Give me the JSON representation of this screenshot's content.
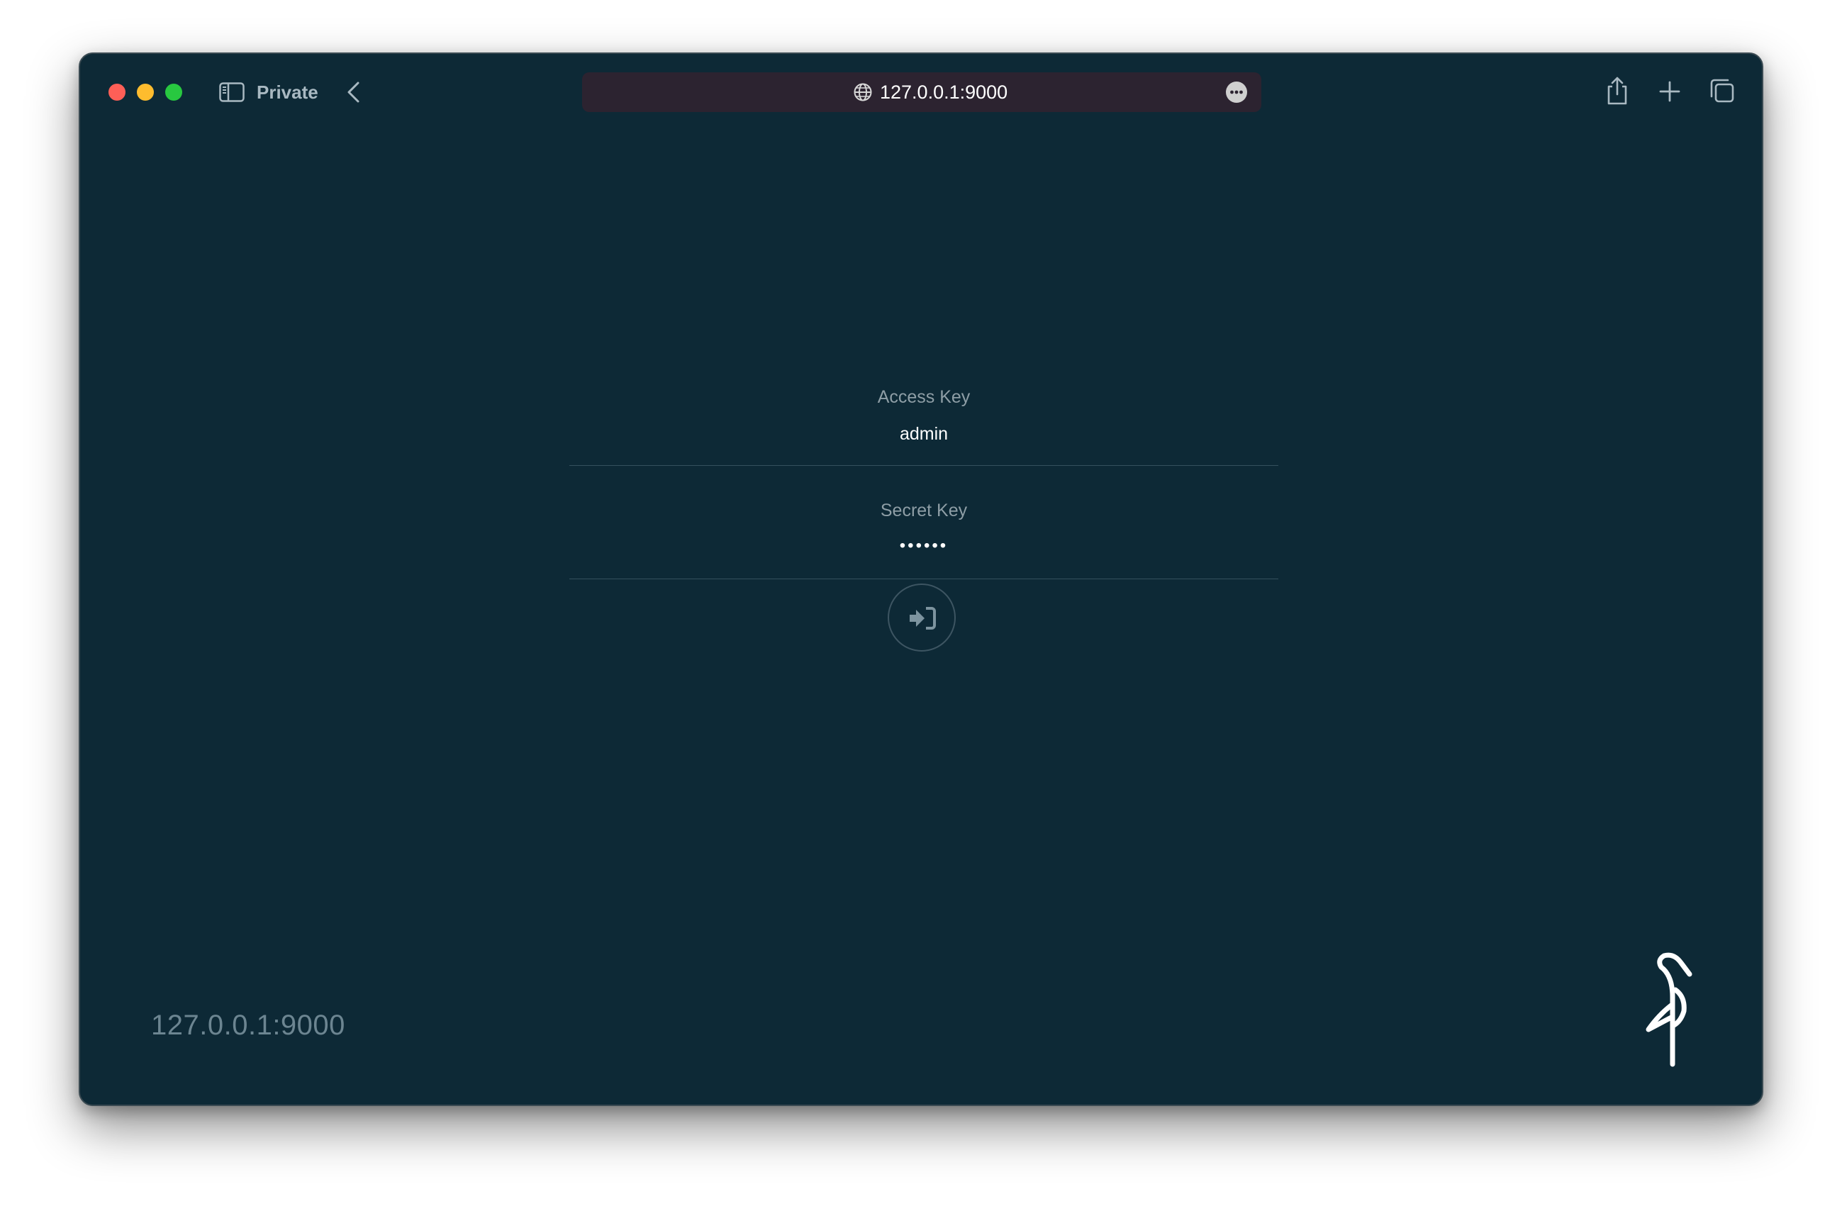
{
  "browser": {
    "mode_label": "Private",
    "url": "127.0.0.1:9000",
    "traffic_colors": {
      "close": "#fe5f57",
      "minimize": "#febc2e",
      "zoom": "#28c840"
    },
    "icons": [
      "sidebar-icon",
      "back-icon",
      "globe-icon",
      "more-icon",
      "share-icon",
      "new-tab-icon",
      "tab-overview-icon"
    ]
  },
  "login": {
    "access_key_label": "Access Key",
    "access_key_value": "admin",
    "secret_key_label": "Secret Key",
    "secret_key_value": "••••••",
    "submit_icon": "sign-in-icon"
  },
  "footer": {
    "host": "127.0.0.1:9000",
    "logo": "minio-bird-logo"
  },
  "colors": {
    "background": "#0d2936",
    "url_bar": "#2c2330",
    "label": "#8e9ea6",
    "divider": "#34505d"
  }
}
